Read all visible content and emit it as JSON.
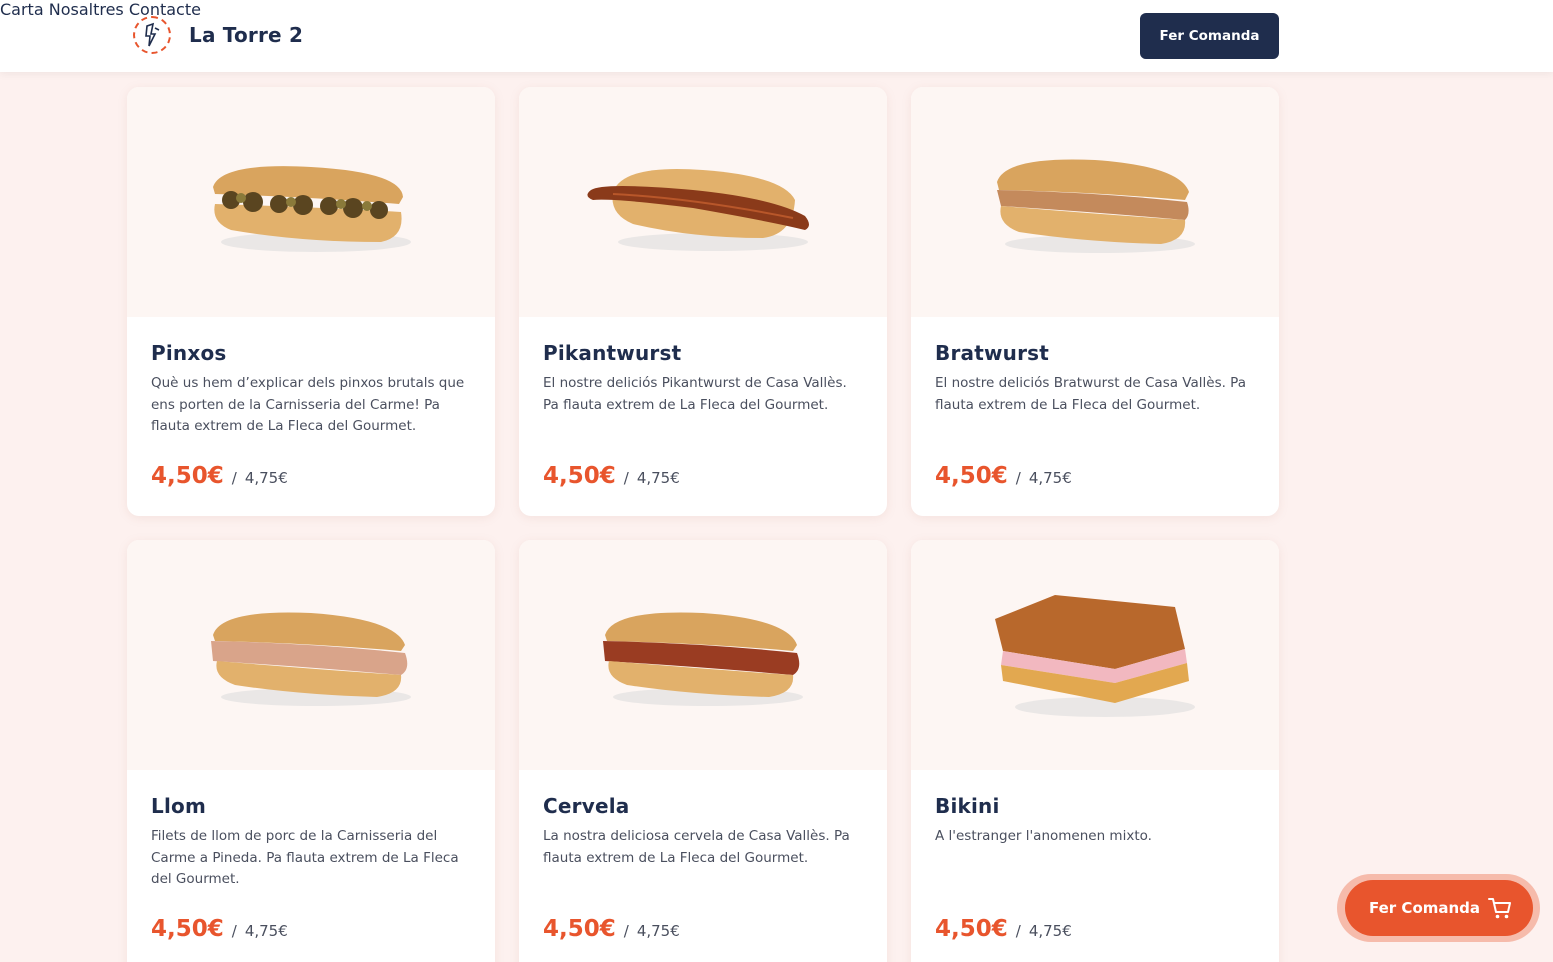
{
  "header": {
    "brand": "La Torre 2",
    "logo_icon": "la-torre-logo",
    "nav": [
      "Carta",
      "Nosaltres",
      "Contacte"
    ],
    "cta_label": "Fer Comanda"
  },
  "products": [
    {
      "name": "Pinxos",
      "description": "Què us hem d’explicar dels pinxos brutals que ens porten de la Carnisseria del Carme! Pa flauta extrem de La Fleca del Gourmet.",
      "price": "4,50€",
      "separator": "/",
      "price_alt": "4,75€"
    },
    {
      "name": "Pikantwurst",
      "description": "El nostre deliciós Pikantwurst de Casa Vallès. Pa flauta extrem de La Fleca del Gourmet.",
      "price": "4,50€",
      "separator": "/",
      "price_alt": "4,75€"
    },
    {
      "name": "Bratwurst",
      "description": "El nostre deliciós Bratwurst de Casa Vallès. Pa flauta extrem de La Fleca del Gourmet.",
      "price": "4,50€",
      "separator": "/",
      "price_alt": "4,75€"
    },
    {
      "name": "Llom",
      "description": "Filets de llom de porc de la Carnisseria del Carme a Pineda. Pa flauta extrem de La Fleca del Gourmet.",
      "price": "4,50€",
      "separator": "/",
      "price_alt": "4,75€"
    },
    {
      "name": "Cervela",
      "description": "La nostra deliciosa cervela de Casa Vallès. Pa flauta extrem de La Fleca del Gourmet.",
      "price": "4,50€",
      "separator": "/",
      "price_alt": "4,75€"
    },
    {
      "name": "Bikini",
      "description": "A l'estranger l'anomenen mixto.",
      "price": "4,50€",
      "separator": "/",
      "price_alt": "4,75€"
    }
  ],
  "floating_cta": {
    "label": "Fer Comanda",
    "icon": "cart-icon"
  },
  "colors": {
    "accent": "#e8552d",
    "navy": "#1f2d4d",
    "background": "#fdf1ef"
  }
}
